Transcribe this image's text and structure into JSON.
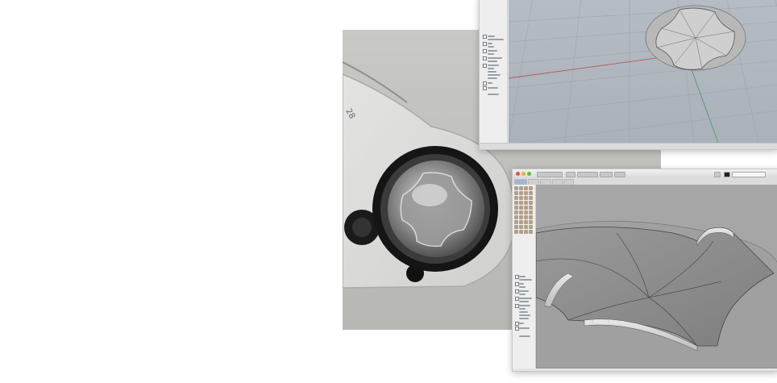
{
  "photo": {
    "description_label": "",
    "label_text": "28"
  },
  "window_top": {
    "layers_panel_items": 14,
    "status_text": ""
  },
  "window_bottom": {
    "title": "",
    "tabs": [
      "",
      "",
      "",
      "",
      ""
    ],
    "layers_panel_items": 14
  },
  "colors": {
    "viewport_top": "#b5bcc4",
    "viewport_bottom": "#a9a9a9",
    "x_axis": "#b34b4b",
    "y_axis": "#3f9e55",
    "model_surface": "#8f8f8f"
  }
}
